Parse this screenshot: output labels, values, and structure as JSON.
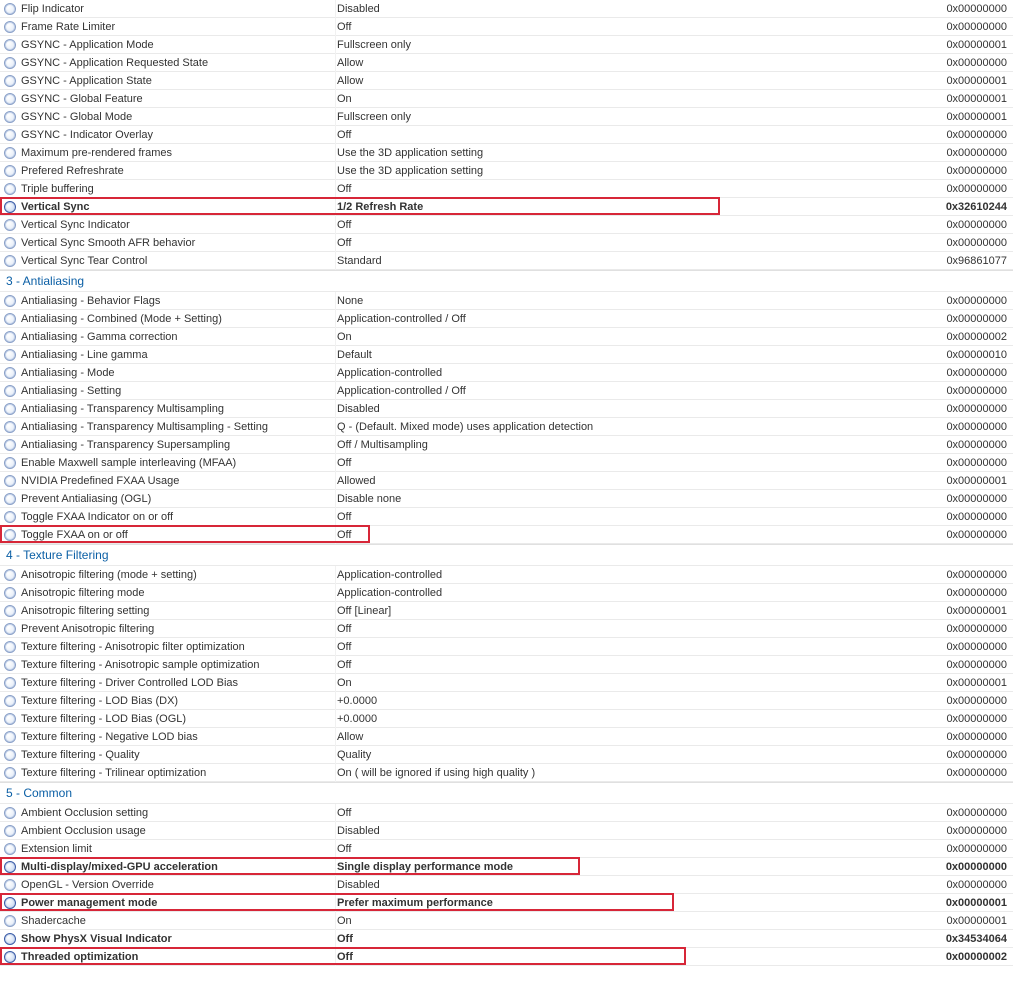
{
  "sections": [
    {
      "rows": [
        {
          "name": "Flip Indicator",
          "value": "Disabled",
          "hex": "0x00000000"
        },
        {
          "name": "Frame Rate Limiter",
          "value": "Off",
          "hex": "0x00000000"
        },
        {
          "name": "GSYNC - Application Mode",
          "value": "Fullscreen only",
          "hex": "0x00000001"
        },
        {
          "name": "GSYNC - Application Requested State",
          "value": "Allow",
          "hex": "0x00000000"
        },
        {
          "name": "GSYNC - Application State",
          "value": "Allow",
          "hex": "0x00000001"
        },
        {
          "name": "GSYNC - Global Feature",
          "value": "On",
          "hex": "0x00000001"
        },
        {
          "name": "GSYNC - Global Mode",
          "value": "Fullscreen only",
          "hex": "0x00000001"
        },
        {
          "name": "GSYNC - Indicator Overlay",
          "value": "Off",
          "hex": "0x00000000"
        },
        {
          "name": "Maximum pre-rendered frames",
          "value": "Use the 3D application setting",
          "hex": "0x00000000"
        },
        {
          "name": "Prefered Refreshrate",
          "value": "Use the 3D application setting",
          "hex": "0x00000000"
        },
        {
          "name": "Triple buffering",
          "value": "Off",
          "hex": "0x00000000"
        },
        {
          "name": "Vertical Sync",
          "value": "1/2 Refresh Rate",
          "hex": "0x32610244",
          "bold": true,
          "hl_width": 720
        },
        {
          "name": "Vertical Sync Indicator",
          "value": "Off",
          "hex": "0x00000000"
        },
        {
          "name": "Vertical Sync Smooth AFR behavior",
          "value": "Off",
          "hex": "0x00000000"
        },
        {
          "name": "Vertical Sync Tear Control",
          "value": "Standard",
          "hex": "0x96861077"
        }
      ]
    },
    {
      "header": "3 - Antialiasing",
      "rows": [
        {
          "name": "Antialiasing - Behavior Flags",
          "value": "None",
          "hex": "0x00000000"
        },
        {
          "name": "Antialiasing - Combined (Mode + Setting)",
          "value": "Application-controlled / Off",
          "hex": "0x00000000"
        },
        {
          "name": "Antialiasing - Gamma correction",
          "value": "On",
          "hex": "0x00000002"
        },
        {
          "name": "Antialiasing - Line gamma",
          "value": "Default",
          "hex": "0x00000010"
        },
        {
          "name": "Antialiasing - Mode",
          "value": "Application-controlled",
          "hex": "0x00000000"
        },
        {
          "name": "Antialiasing - Setting",
          "value": "Application-controlled / Off",
          "hex": "0x00000000"
        },
        {
          "name": "Antialiasing - Transparency Multisampling",
          "value": "Disabled",
          "hex": "0x00000000"
        },
        {
          "name": "Antialiasing - Transparency Multisampling - Setting",
          "value": "Q - (Default. Mixed mode) uses application detection",
          "hex": "0x00000000"
        },
        {
          "name": "Antialiasing - Transparency Supersampling",
          "value": "Off / Multisampling",
          "hex": "0x00000000"
        },
        {
          "name": "Enable Maxwell sample interleaving (MFAA)",
          "value": "Off",
          "hex": "0x00000000"
        },
        {
          "name": "NVIDIA Predefined FXAA Usage",
          "value": "Allowed",
          "hex": "0x00000001"
        },
        {
          "name": "Prevent Antialiasing (OGL)",
          "value": "Disable none",
          "hex": "0x00000000"
        },
        {
          "name": "Toggle FXAA Indicator on or off",
          "value": "Off",
          "hex": "0x00000000"
        },
        {
          "name": "Toggle FXAA on or off",
          "value": "Off",
          "hex": "0x00000000",
          "hl_width": 370
        }
      ]
    },
    {
      "header": "4 - Texture Filtering",
      "rows": [
        {
          "name": "Anisotropic filtering (mode + setting)",
          "value": "Application-controlled",
          "hex": "0x00000000"
        },
        {
          "name": "Anisotropic filtering mode",
          "value": "Application-controlled",
          "hex": "0x00000000"
        },
        {
          "name": "Anisotropic filtering setting",
          "value": "Off [Linear]",
          "hex": "0x00000001"
        },
        {
          "name": "Prevent Anisotropic filtering",
          "value": "Off",
          "hex": "0x00000000"
        },
        {
          "name": "Texture filtering - Anisotropic filter optimization",
          "value": "Off",
          "hex": "0x00000000"
        },
        {
          "name": "Texture filtering - Anisotropic sample optimization",
          "value": "Off",
          "hex": "0x00000000"
        },
        {
          "name": "Texture filtering - Driver Controlled LOD Bias",
          "value": "On",
          "hex": "0x00000001"
        },
        {
          "name": "Texture filtering - LOD Bias (DX)",
          "value": "+0.0000",
          "hex": "0x00000000"
        },
        {
          "name": "Texture filtering - LOD Bias (OGL)",
          "value": "+0.0000",
          "hex": "0x00000000"
        },
        {
          "name": "Texture filtering - Negative LOD bias",
          "value": "Allow",
          "hex": "0x00000000"
        },
        {
          "name": "Texture filtering - Quality",
          "value": "Quality",
          "hex": "0x00000000"
        },
        {
          "name": "Texture filtering - Trilinear optimization",
          "value": "On ( will be ignored if using high quality )",
          "hex": "0x00000000"
        }
      ]
    },
    {
      "header": "5 - Common",
      "rows": [
        {
          "name": "Ambient Occlusion setting",
          "value": "Off",
          "hex": "0x00000000"
        },
        {
          "name": "Ambient Occlusion usage",
          "value": "Disabled",
          "hex": "0x00000000"
        },
        {
          "name": "Extension limit",
          "value": "Off",
          "hex": "0x00000000"
        },
        {
          "name": "Multi-display/mixed-GPU acceleration",
          "value": "Single display performance mode",
          "hex": "0x00000000",
          "bold": true,
          "hl_width": 580
        },
        {
          "name": "OpenGL - Version Override",
          "value": "Disabled",
          "hex": "0x00000000"
        },
        {
          "name": "Power management mode",
          "value": "Prefer maximum performance",
          "hex": "0x00000001",
          "bold": true,
          "hl_width": 674
        },
        {
          "name": "Shadercache",
          "value": "On",
          "hex": "0x00000001"
        },
        {
          "name": "Show PhysX Visual Indicator",
          "value": "Off",
          "hex": "0x34534064",
          "bold": true
        },
        {
          "name": "Threaded optimization",
          "value": "Off",
          "hex": "0x00000002",
          "bold": true,
          "hl_width": 686
        }
      ]
    }
  ]
}
